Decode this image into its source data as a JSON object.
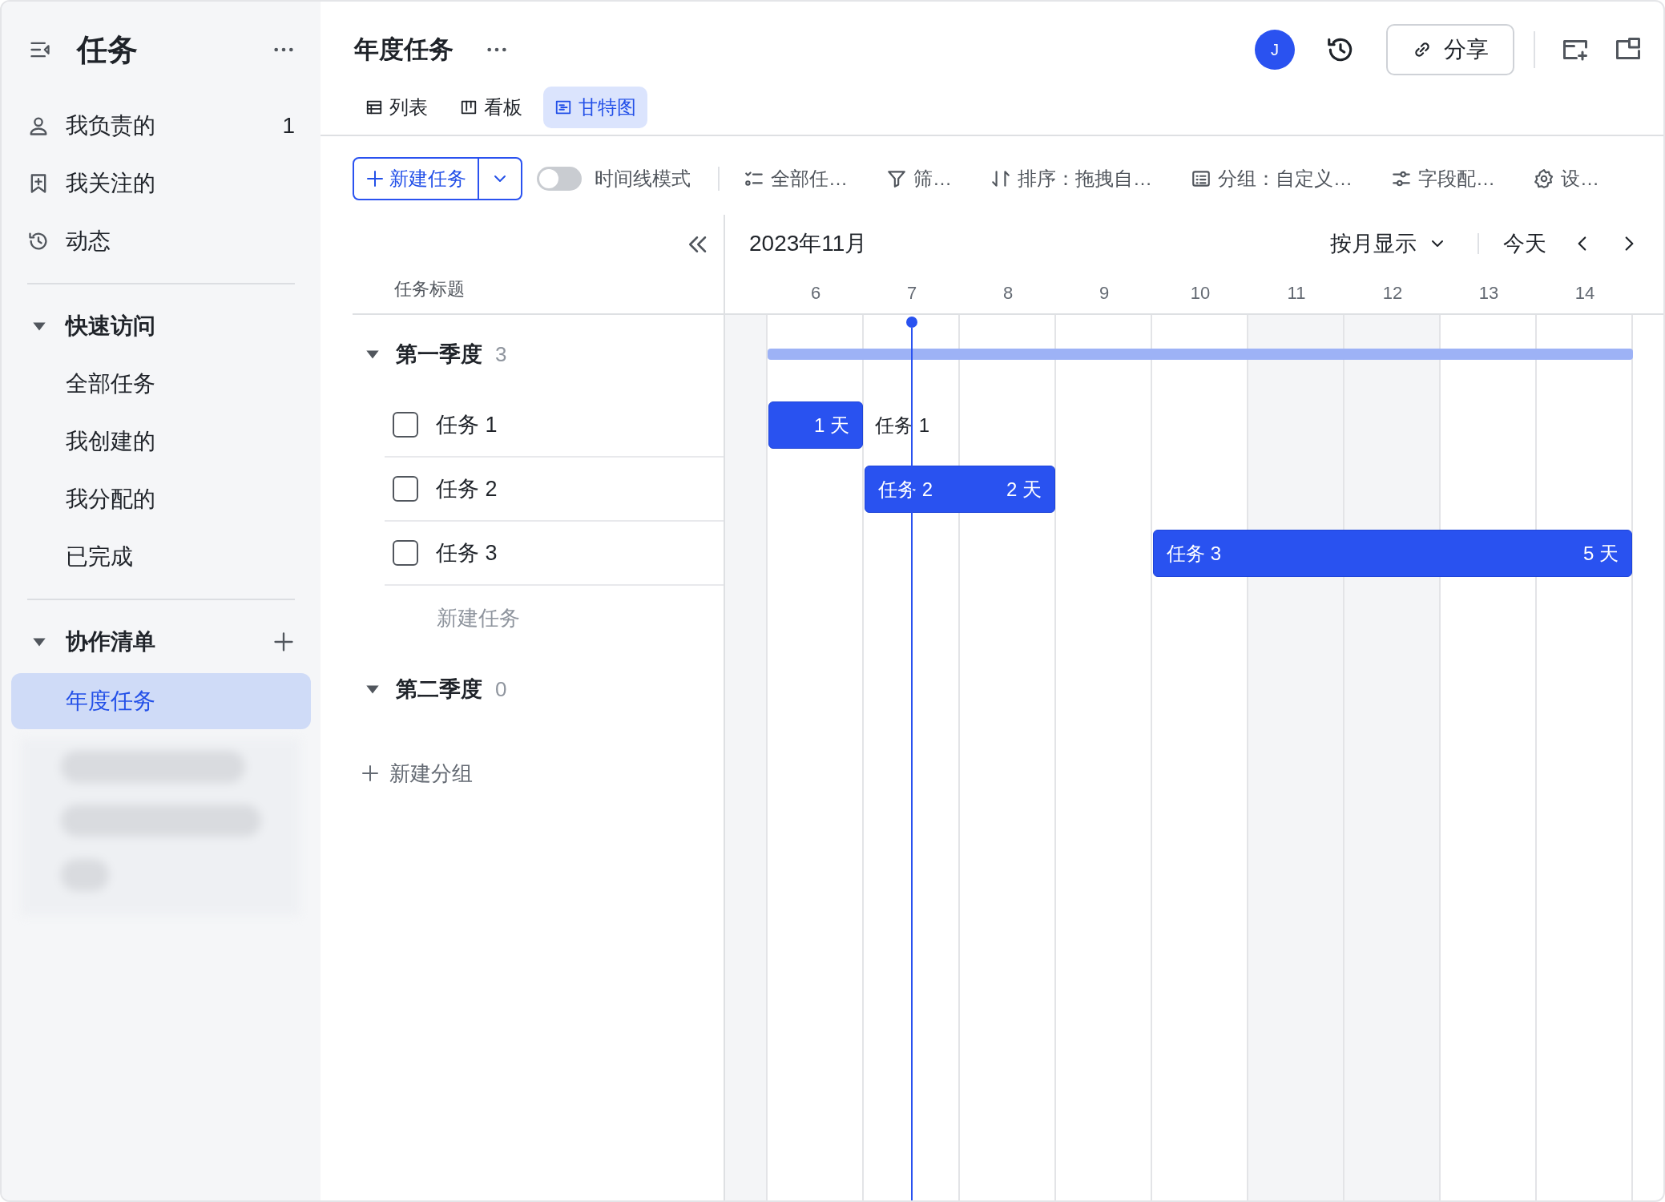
{
  "sidebar": {
    "title": "任务",
    "items": [
      {
        "label": "我负责的",
        "count": "1"
      },
      {
        "label": "我关注的"
      },
      {
        "label": "动态"
      }
    ],
    "sections": [
      {
        "title": "快速访问",
        "expanded": true,
        "addable": false,
        "items": [
          {
            "label": "全部任务",
            "selected": false
          },
          {
            "label": "我创建的",
            "selected": false
          },
          {
            "label": "我分配的",
            "selected": false
          },
          {
            "label": "已完成",
            "selected": false
          }
        ]
      },
      {
        "title": "协作清单",
        "expanded": true,
        "addable": true,
        "items": [
          {
            "label": "年度任务",
            "selected": true
          }
        ]
      }
    ]
  },
  "header": {
    "title": "年度任务",
    "avatar": "J",
    "share": "分享"
  },
  "tabs": [
    {
      "label": "列表",
      "selected": false
    },
    {
      "label": "看板",
      "selected": false
    },
    {
      "label": "甘特图",
      "selected": true
    }
  ],
  "toolbar": {
    "new_task": "新建任务",
    "timeline_mode": {
      "label": "时间线模式",
      "on": false
    },
    "tools": [
      "全部任…",
      "筛…",
      "排序：拖拽自…",
      "分组：自定义…",
      "字段配…",
      "设…"
    ]
  },
  "gantt": {
    "column_title": "任务标题",
    "month": "2023年11月",
    "scale": "按月显示",
    "today": "今天",
    "days": [
      {
        "label": "6",
        "weekend": false,
        "today": false
      },
      {
        "label": "7",
        "weekend": false,
        "today": true
      },
      {
        "label": "8",
        "weekend": false,
        "today": false
      },
      {
        "label": "9",
        "weekend": false,
        "today": false
      },
      {
        "label": "10",
        "weekend": false,
        "today": false
      },
      {
        "label": "11",
        "weekend": true,
        "today": false
      },
      {
        "label": "12",
        "weekend": true,
        "today": false
      },
      {
        "label": "13",
        "weekend": false,
        "today": false
      },
      {
        "label": "14",
        "weekend": false,
        "today": false
      }
    ],
    "groups": [
      {
        "title": "第一季度",
        "count": "3",
        "expanded": true,
        "new_task": "新建任务",
        "tasks": [
          {
            "title": "任务 1",
            "done": false,
            "bar_label": "任务 1",
            "duration": "1 天"
          },
          {
            "title": "任务 2",
            "done": false,
            "bar_label": "任务 2",
            "duration": "2 天"
          },
          {
            "title": "任务 3",
            "done": false,
            "bar_label": "任务 3",
            "duration": "5 天"
          }
        ]
      },
      {
        "title": "第二季度",
        "count": "0",
        "expanded": true
      }
    ],
    "new_group": "新建分组"
  }
}
